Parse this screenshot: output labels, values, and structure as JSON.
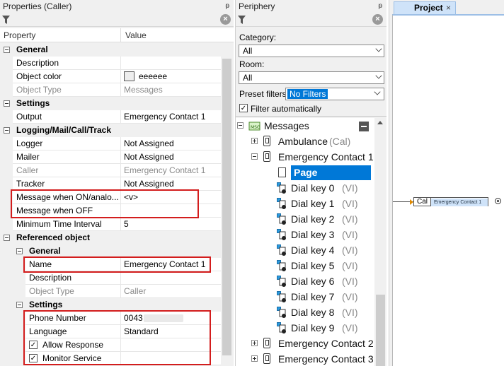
{
  "properties_panel": {
    "title": "Properties (Caller)",
    "pin": "ᵽ",
    "clear": "×",
    "col_property": "Property",
    "col_value": "Value",
    "rows": {
      "general": "General",
      "description": "Description",
      "object_color": "Object color",
      "object_color_value": "eeeeee",
      "object_type": "Object Type",
      "object_type_value": "Messages",
      "settings": "Settings",
      "output": "Output",
      "output_value": "Emergency Contact 1",
      "logging": "Logging/Mail/Call/Track",
      "logger": "Logger",
      "logger_value": "Not Assigned",
      "mailer": "Mailer",
      "mailer_value": "Not Assigned",
      "caller": "Caller",
      "caller_value": "Emergency Contact 1",
      "tracker": "Tracker",
      "tracker_value": "Not Assigned",
      "msg_on": "Message when ON/analo...",
      "msg_on_value": "<v>",
      "msg_off": "Message when OFF",
      "min_time": "Minimum Time Interval",
      "min_time_value": "5",
      "referenced": "Referenced object",
      "ref_general": "General",
      "name": "Name",
      "name_value": "Emergency Contact 1",
      "ref_description": "Description",
      "ref_object_type": "Object Type",
      "ref_object_type_value": "Caller",
      "ref_settings": "Settings",
      "phone": "Phone Number",
      "phone_value": "0043",
      "language": "Language",
      "language_value": "Standard",
      "allow_response": "Allow Response",
      "monitor_service": "Monitor Service",
      "check": "✓"
    },
    "highlight_color": "#d31d1d"
  },
  "periphery_panel": {
    "title": "Periphery",
    "pin": "ᵽ",
    "clear": "×",
    "category_label": "Category:",
    "category_value": "All",
    "room_label": "Room:",
    "room_value": "All",
    "preset_label": "Preset filters",
    "preset_value": "No Filters",
    "filter_auto_label": "Filter automatically",
    "check": "✓",
    "tree": {
      "root": "Messages",
      "ambulance": "Ambulance",
      "ambulance_tag": "(Cal)",
      "ec1": "Emergency Contact 1",
      "page": "Page",
      "dial_keys": [
        "Dial key 0",
        "Dial key 1",
        "Dial key 2",
        "Dial key 3",
        "Dial key 4",
        "Dial key 5",
        "Dial key 6",
        "Dial key 7",
        "Dial key 8",
        "Dial key 9"
      ],
      "vi_tag": "(VI)",
      "ec2": "Emergency Contact 2",
      "ec3": "Emergency Contact 3"
    }
  },
  "project_panel": {
    "tab_label": "Project",
    "tab_close": "×",
    "block_type": "Cal",
    "block_name": "Emergency Contact 1"
  }
}
